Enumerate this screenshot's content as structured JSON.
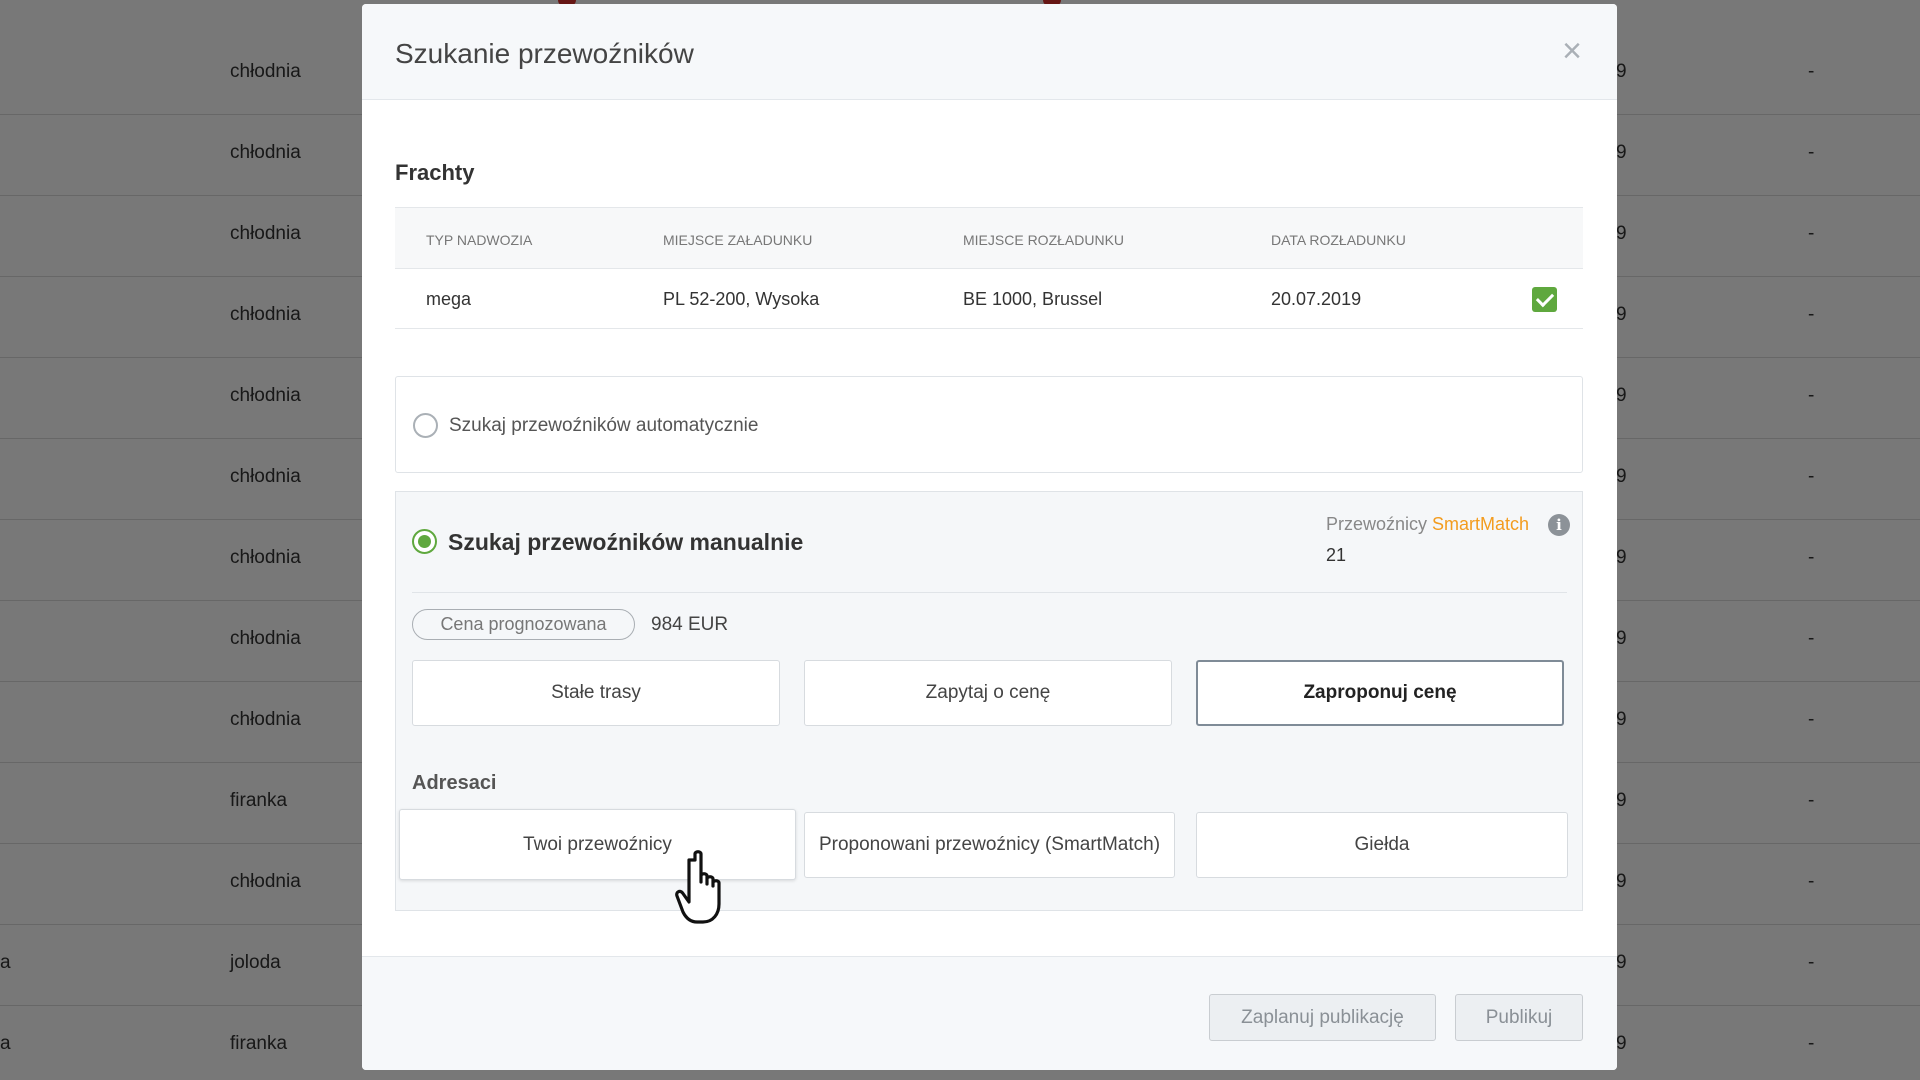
{
  "background_rows": [
    {
      "left": "",
      "type": "chłodnia",
      "date": "9",
      "dash": "-"
    },
    {
      "left": "",
      "type": "chłodnia",
      "date": "9",
      "dash": "-"
    },
    {
      "left": "",
      "type": "chłodnia",
      "date": "9",
      "dash": "-"
    },
    {
      "left": "",
      "type": "chłodnia",
      "date": "9",
      "dash": "-"
    },
    {
      "left": "",
      "type": "chłodnia",
      "date": "9",
      "dash": "-"
    },
    {
      "left": "",
      "type": "chłodnia",
      "date": "9",
      "dash": "-"
    },
    {
      "left": "",
      "type": "chłodnia",
      "date": "9",
      "dash": "-"
    },
    {
      "left": "",
      "type": "chłodnia",
      "date": "9",
      "dash": "-"
    },
    {
      "left": "",
      "type": "chłodnia",
      "date": "9",
      "dash": "-"
    },
    {
      "left": "",
      "type": "firanka",
      "date": "9",
      "dash": "-"
    },
    {
      "left": "",
      "type": "chłodnia",
      "date": "9",
      "dash": "-"
    },
    {
      "left": "a",
      "type": "joloda",
      "date": "9",
      "dash": "-"
    },
    {
      "left": "a",
      "type": "firanka",
      "date": "9",
      "dash": "-"
    }
  ],
  "modal": {
    "title": "Szukanie przewoźników",
    "close_icon": "×",
    "freight_section": {
      "title": "Frachty",
      "columns": [
        "TYP NADWOZIA",
        "MIEJSCE ZAŁADUNKU",
        "MIEJSCE ROZŁADUNKU",
        "DATA ROZŁADUNKU"
      ],
      "rows": [
        {
          "body_type": "mega",
          "loading_place": "PL 52-200, Wysoka",
          "unloading_place": "BE 1000, Brussel",
          "unloading_date": "20.07.2019",
          "checked": true
        }
      ]
    },
    "auto_search": {
      "label": "Szukaj przewoźników automatycznie",
      "selected": false
    },
    "manual_search": {
      "label": "Szukaj przewoźników manualnie",
      "selected": true,
      "smartmatch_prefix": "Przewoźnicy",
      "smartmatch_brand": "SmartMatch",
      "smartmatch_count": "21",
      "info_icon": "i",
      "price_pill_label": "Cena prognozowana",
      "price_value": "984 EUR",
      "options": [
        "Stałe trasy",
        "Zapytaj o cenę",
        "Zaproponuj cenę"
      ],
      "selected_option": "Zaproponuj cenę",
      "addressees_label": "Adresaci",
      "addressees": [
        "Twoi przewoźnicy",
        "Proponowani przewoźnicy (SmartMatch)",
        "Giełda"
      ]
    },
    "footer": {
      "schedule_label": "Zaplanuj publikację",
      "publish_label": "Publikuj"
    }
  },
  "colors": {
    "accent_green": "#5fa83e",
    "smartmatch_orange": "#f39c1f",
    "overlay": "rgba(0,0,0,0.53)"
  }
}
